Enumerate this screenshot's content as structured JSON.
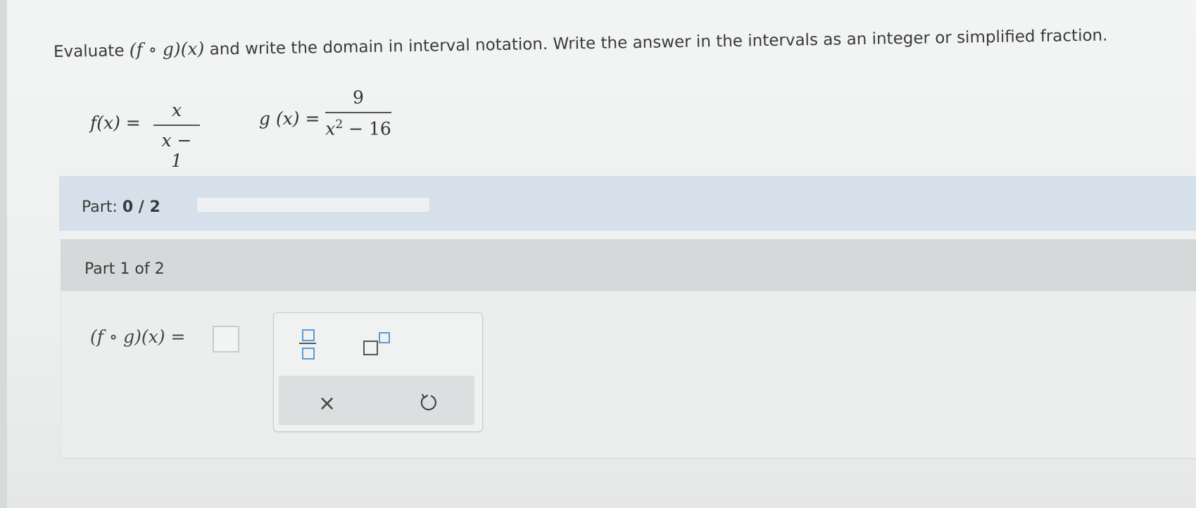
{
  "question": {
    "text_before": "Evaluate",
    "composition": "(f ∘ g)(x)",
    "text_after": "and write the domain in interval notation. Write the answer in the intervals as an integer or simplified fraction."
  },
  "functions": {
    "f_lhs": "f(x) =",
    "f_num": "x",
    "f_den": "x − 1",
    "g_lhs": "g (x) =",
    "g_num": "9",
    "g_den_base": "x",
    "g_den_exp": "2",
    "g_den_rest": " − 16"
  },
  "progress": {
    "label": "Part:",
    "value": "0 / 2",
    "fraction": 0
  },
  "part": {
    "title": "Part 1 of 2",
    "answer_label": "(f ∘ g)(x) ="
  },
  "palette": {
    "fraction_icon": "fraction-template-icon",
    "power_icon": "exponent-template-icon",
    "clear_glyph": "×",
    "undo_icon": "undo-icon"
  },
  "colors": {
    "part_band": "#d5e0ea",
    "panel_header": "#d6d9da",
    "template_accent": "#5a9bd5"
  }
}
